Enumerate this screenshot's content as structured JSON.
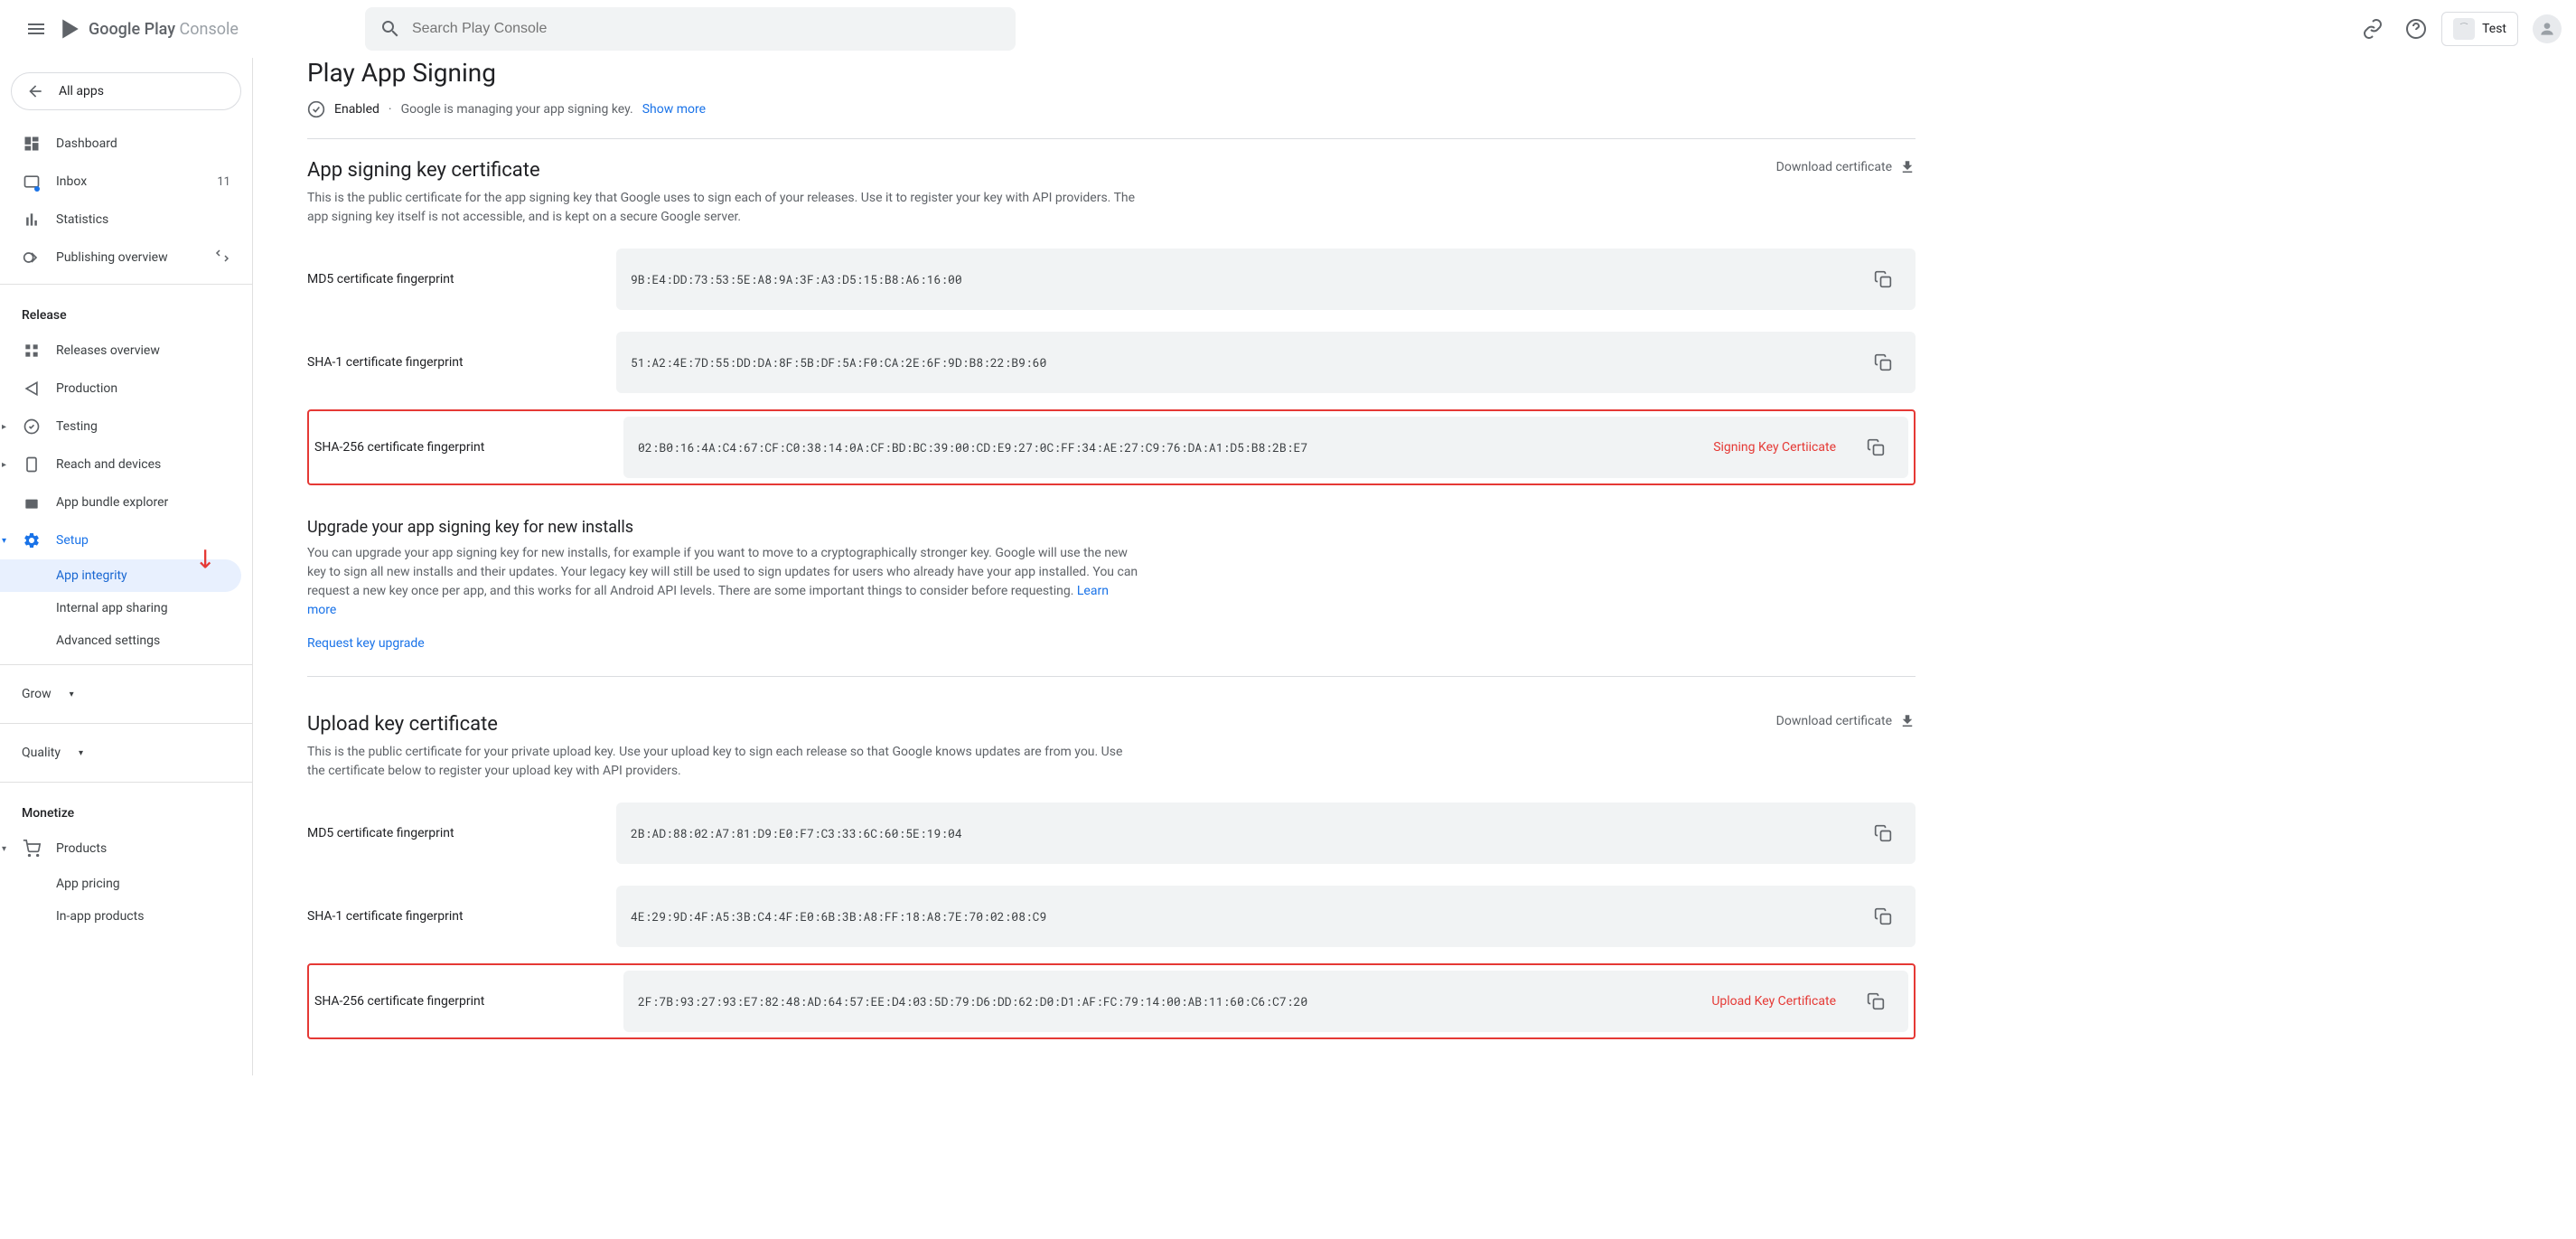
{
  "header": {
    "logo_play": "Google Play",
    "logo_console": "Console",
    "search_placeholder": "Search Play Console",
    "app_name": "Test"
  },
  "sidebar": {
    "all_apps": "All apps",
    "items": [
      {
        "label": "Dashboard"
      },
      {
        "label": "Inbox",
        "badge": "11"
      },
      {
        "label": "Statistics"
      },
      {
        "label": "Publishing overview"
      }
    ],
    "release_label": "Release",
    "release_items": [
      {
        "label": "Releases overview"
      },
      {
        "label": "Production"
      },
      {
        "label": "Testing"
      },
      {
        "label": "Reach and devices"
      },
      {
        "label": "App bundle explorer"
      },
      {
        "label": "Setup"
      }
    ],
    "setup_items": [
      {
        "label": "App integrity"
      },
      {
        "label": "Internal app sharing"
      },
      {
        "label": "Advanced settings"
      }
    ],
    "grow_label": "Grow",
    "quality_label": "Quality",
    "monetize_label": "Monetize",
    "monetize_items": [
      {
        "label": "Products"
      },
      {
        "label": "App pricing"
      },
      {
        "label": "In-app products"
      }
    ]
  },
  "main": {
    "title": "Play App Signing",
    "status_enabled": "Enabled",
    "status_text": "Google is managing your app signing key.",
    "show_more": "Show more",
    "signing_section": {
      "title": "App signing key certificate",
      "desc": "This is the public certificate for the app signing key that Google uses to sign each of your releases. Use it to register your key with API providers. The app signing key itself is not accessible, and is kept on a secure Google server.",
      "download": "Download certificate",
      "md5_label": "MD5 certificate fingerprint",
      "md5_value": "9B:E4:DD:73:53:5E:A8:9A:3F:A3:D5:15:B8:A6:16:00",
      "sha1_label": "SHA-1 certificate fingerprint",
      "sha1_value": "51:A2:4E:7D:55:DD:DA:8F:5B:DF:5A:F0:CA:2E:6F:9D:B8:22:B9:60",
      "sha256_label": "SHA-256 certificate fingerprint",
      "sha256_value": "02:B0:16:4A:C4:67:CF:C0:38:14:0A:CF:BD:BC:39:00:CD:E9:27:0C:FF:34:AE:27:C9:76:DA:A1:D5:B8:2B:E7",
      "red_label": "Signing Key Certiicate"
    },
    "upgrade_section": {
      "title": "Upgrade your app signing key for new installs",
      "desc": "You can upgrade your app signing key for new installs, for example if you want to move to a cryptographically stronger key. Google will use the new key to sign all new installs and their updates. Your legacy key will still be used to sign updates for users who already have your app installed. You can request a new key once per app, and this works for all Android API levels. There are some important things to consider before requesting.",
      "learn_more": "Learn more",
      "request_link": "Request key upgrade"
    },
    "upload_section": {
      "title": "Upload key certificate",
      "desc": "This is the public certificate for your private upload key. Use your upload key to sign each release so that Google knows updates are from you. Use the certificate below to register your upload key with API providers.",
      "download": "Download certificate",
      "md5_label": "MD5 certificate fingerprint",
      "md5_value": "2B:AD:88:02:A7:81:D9:E0:F7:C3:33:6C:60:5E:19:04",
      "sha1_label": "SHA-1 certificate fingerprint",
      "sha1_value": "4E:29:9D:4F:A5:3B:C4:4F:E0:6B:3B:A8:FF:18:A8:7E:70:02:08:C9",
      "sha256_label": "SHA-256 certificate fingerprint",
      "sha256_value": "2F:7B:93:27:93:E7:82:48:AD:64:57:EE:D4:03:5D:79:D6:DD:62:D0:D1:AF:FC:79:14:00:AB:11:60:C6:C7:20",
      "red_label": "Upload Key Certificate"
    }
  }
}
